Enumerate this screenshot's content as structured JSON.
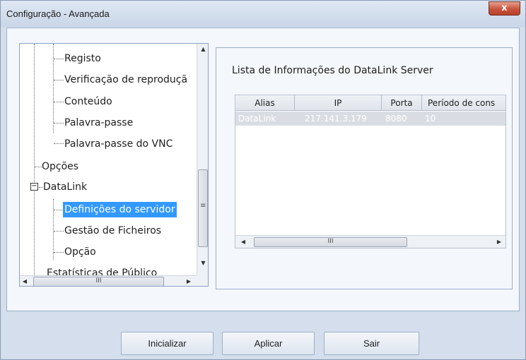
{
  "window": {
    "title": "Configuração - Avançada",
    "close_glyph": "x"
  },
  "tree": {
    "items": [
      {
        "label": "Registo",
        "selected": false
      },
      {
        "label": "Verificação de reproduçã",
        "selected": false
      },
      {
        "label": "Conteúdo",
        "selected": false
      },
      {
        "label": "Palavra-passe",
        "selected": false
      },
      {
        "label": "Palavra-passe do VNC",
        "selected": false
      },
      {
        "label": "Opções",
        "selected": false
      },
      {
        "label": "DataLink",
        "selected": false,
        "expander": "−"
      },
      {
        "label": "Definições do servidor",
        "selected": true
      },
      {
        "label": "Gestão de Ficheiros",
        "selected": false
      },
      {
        "label": "Opção",
        "selected": false
      },
      {
        "label": "Estatísticas de Público",
        "selected": false
      }
    ],
    "scroll_grip": "≡",
    "hscroll_grip": "III"
  },
  "server_panel": {
    "title": "Lista de Informações do DataLink Server",
    "columns": [
      "Alias",
      "IP",
      "Porta",
      "Período de cons"
    ],
    "rows": [
      [
        "DataLink",
        "217.141.3.179",
        "8080",
        "10"
      ]
    ],
    "hscroll_grip": "III"
  },
  "buttons": {
    "init": "Inicializar",
    "apply": "Aplicar",
    "exit": "Sair"
  },
  "colors": {
    "selection": "#3399ff",
    "window_bg": "#d4deec",
    "close": "#c8533c"
  }
}
